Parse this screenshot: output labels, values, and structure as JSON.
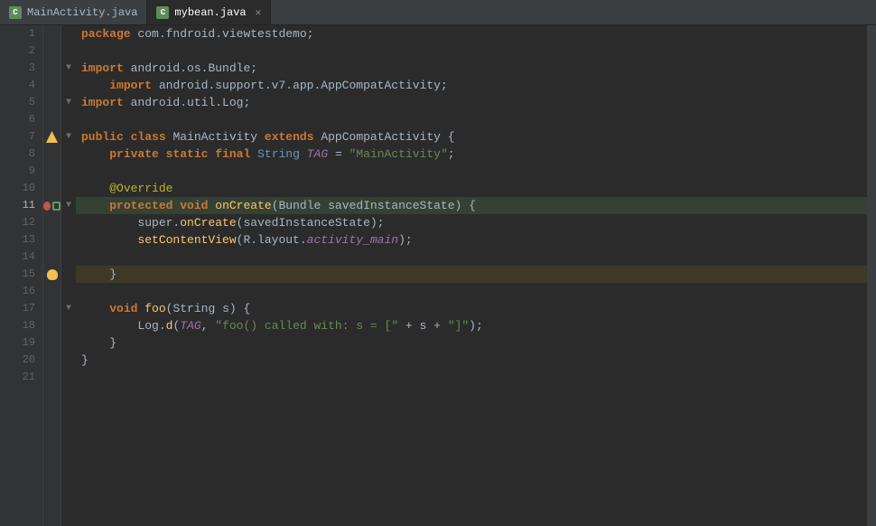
{
  "tabs": [
    {
      "label": "MainActivity.java",
      "active": false,
      "icon": "C",
      "icon_color": "#f5a623",
      "closable": false
    },
    {
      "label": "mybean.java",
      "active": true,
      "icon": "C",
      "icon_color": "#f5a623",
      "closable": true
    }
  ],
  "lines": [
    {
      "num": 1,
      "gutter_icons": [],
      "fold": "",
      "code_html": "<span class='kw-package'>package</span> <span class='plain'>com.fndroid.viewtestdemo;</span>"
    },
    {
      "num": 2,
      "gutter_icons": [],
      "fold": "",
      "code_html": ""
    },
    {
      "num": 3,
      "gutter_icons": [],
      "fold": "collapse",
      "code_html": "<span class='kw-import'>import</span> <span class='plain'>android.os.Bundle;</span>"
    },
    {
      "num": 4,
      "gutter_icons": [],
      "fold": "",
      "code_html": "&nbsp;&nbsp;&nbsp;&nbsp;<span class='kw-import'>import</span> <span class='plain'>android.support.v7.app.AppCompatActivity;</span>"
    },
    {
      "num": 5,
      "gutter_icons": [],
      "fold": "collapse",
      "code_html": "<span class='kw-import'>import</span> <span class='plain'>android.util.Log;</span>"
    },
    {
      "num": 6,
      "gutter_icons": [],
      "fold": "",
      "code_html": ""
    },
    {
      "num": 7,
      "gutter_icons": [
        "warning"
      ],
      "fold": "collapse-open",
      "code_html": "<span class='kw-public'>public</span> <span class='kw-class'>class</span> <span class='class-ref'>MainActivity</span> <span class='kw-extends'>extends</span> <span class='class-ref'>AppCompatActivity</span> <span class='plain'>{</span>"
    },
    {
      "num": 8,
      "gutter_icons": [],
      "fold": "",
      "code_html": "&nbsp;&nbsp;&nbsp;&nbsp;<span class='kw-private'>private</span> <span class='kw-static'>static</span> <span class='kw-final'>final</span> <span class='type-string'>String</span> <span class='field-access italic'>TAG</span> <span class='plain'>= </span><span class='string-lit'>\"MainActivity\"</span><span class='plain'>;</span>"
    },
    {
      "num": 9,
      "gutter_icons": [],
      "fold": "",
      "code_html": ""
    },
    {
      "num": 10,
      "gutter_icons": [],
      "fold": "",
      "code_html": "&nbsp;&nbsp;&nbsp;&nbsp;<span class='annotation'>@Override</span>"
    },
    {
      "num": 11,
      "gutter_icons": [
        "breakpoint",
        "override"
      ],
      "fold": "collapse-open",
      "code_html": "&nbsp;&nbsp;&nbsp;&nbsp;<span class='kw-protected'>protected</span> <span class='kw-void'>void</span> <span class='method-call'>onCreate</span><span class='plain'>(Bundle savedInstanceState) {</span>"
    },
    {
      "num": 12,
      "gutter_icons": [],
      "fold": "",
      "code_html": "&nbsp;&nbsp;&nbsp;&nbsp;&nbsp;&nbsp;&nbsp;&nbsp;<span class='plain'>super.</span><span class='method-call'>onCreate</span><span class='plain'>(savedInstanceState);</span>"
    },
    {
      "num": 13,
      "gutter_icons": [],
      "fold": "",
      "code_html": "&nbsp;&nbsp;&nbsp;&nbsp;&nbsp;&nbsp;&nbsp;&nbsp;<span class='method-call'>setContentView</span><span class='plain'>(R.layout.</span><span class='field-access italic'>activity_main</span><span class='plain'>);</span>"
    },
    {
      "num": 14,
      "gutter_icons": [],
      "fold": "",
      "code_html": ""
    },
    {
      "num": 15,
      "gutter_icons": [
        "bulb"
      ],
      "fold": "collapse-end",
      "code_html": "&nbsp;&nbsp;&nbsp;&nbsp;<span class='plain'>}</span>",
      "highlight": "yellow"
    },
    {
      "num": 16,
      "gutter_icons": [],
      "fold": "",
      "code_html": ""
    },
    {
      "num": 17,
      "gutter_icons": [],
      "fold": "collapse-open",
      "code_html": "&nbsp;&nbsp;&nbsp;&nbsp;<span class='kw-void'>void</span> <span class='method-call'>foo</span><span class='plain'>(String s) {</span>"
    },
    {
      "num": 18,
      "gutter_icons": [],
      "fold": "",
      "code_html": "&nbsp;&nbsp;&nbsp;&nbsp;&nbsp;&nbsp;&nbsp;&nbsp;<span class='plain'>Log.</span><span class='method-call'>d</span><span class='plain'>(</span><span class='field-access italic'>TAG</span><span class='plain'>, </span><span class='string-lit'>\"foo() called with: s = [\"</span><span class='plain'> + s + </span><span class='string-lit'>\"]\"</span><span class='plain'>);</span>"
    },
    {
      "num": 19,
      "gutter_icons": [],
      "fold": "collapse-end",
      "code_html": "&nbsp;&nbsp;&nbsp;&nbsp;<span class='plain'>}</span>"
    },
    {
      "num": 20,
      "gutter_icons": [],
      "fold": "",
      "code_html": "<span class='plain'>}</span>"
    },
    {
      "num": 21,
      "gutter_icons": [],
      "fold": "",
      "code_html": ""
    }
  ],
  "colors": {
    "bg": "#2b2b2b",
    "gutter_bg": "#313335",
    "tab_active_bg": "#2b2b2b",
    "tab_inactive_bg": "#3c3f41",
    "line_highlight_green": "#344134",
    "line_highlight_yellow": "#3d3926"
  }
}
